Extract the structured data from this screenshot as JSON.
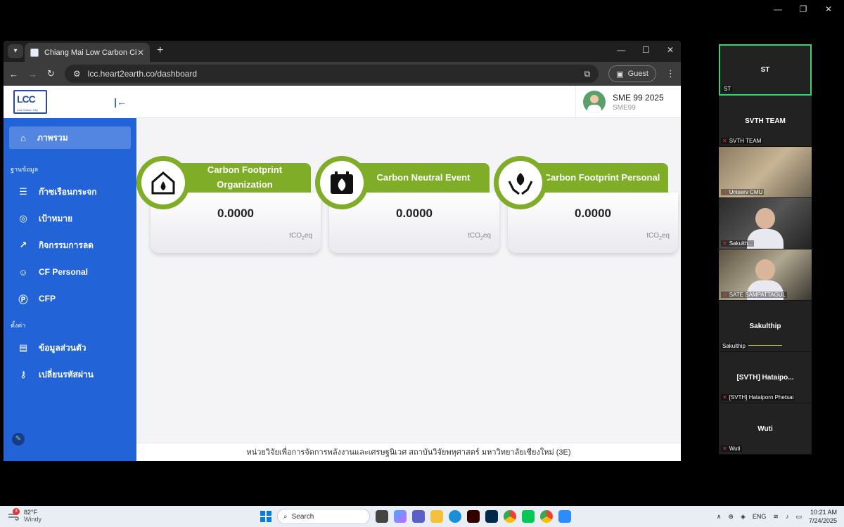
{
  "browser": {
    "tab_title": "Chiang Mai Low Carbon City",
    "url": "lcc.heart2earth.co/dashboard",
    "guest_label": "Guest"
  },
  "sidebar": {
    "logo_text": "LCC",
    "logo_sub": "Low Carbon City",
    "active_item": "ภาพรวม",
    "section_data": "ฐานข้อมูล",
    "data_items": [
      {
        "label": "ก๊าซเรือนกระจก"
      },
      {
        "label": "เป้าหมาย"
      },
      {
        "label": "กิจกรรมการลด"
      },
      {
        "label": "CF Personal"
      },
      {
        "label": "CFP"
      }
    ],
    "section_settings": "ตั้งค่า",
    "settings_items": [
      {
        "label": "ข้อมูลส่วนตัว"
      },
      {
        "label": "เปลี่ยนรหัสผ่าน"
      }
    ]
  },
  "user": {
    "name": "SME 99 2025",
    "id": "SME99"
  },
  "cards": [
    {
      "title": "Carbon Footprint Organization",
      "value": "0.0000",
      "unit_pre": "tCO",
      "unit_sub": "2",
      "unit_post": "eq"
    },
    {
      "title": "Carbon Neutral Event",
      "value": "0.0000",
      "unit_pre": "tCO",
      "unit_sub": "2",
      "unit_post": "eq"
    },
    {
      "title": "Carbon Footprint Personal",
      "value": "0.0000",
      "unit_pre": "tCO",
      "unit_sub": "2",
      "unit_post": "eq"
    }
  ],
  "footer": "หน่วยวิจัยเพื่อการจัดการพลังงานและเศรษฐนิเวศ สถาบันวิจัยพหุศาสตร์ มหาวิทยาลัยเชียงใหม่ (3E)",
  "participants": [
    {
      "name": "ST",
      "label": "ST"
    },
    {
      "name": "SVTH TEAM",
      "label": "SVTH TEAM"
    },
    {
      "label": "Uniserv CMU"
    },
    {
      "label": "Sakulth..."
    },
    {
      "label": "SATE SAMPATTAGUL"
    },
    {
      "name": "Sakulthip",
      "label": "Sakulthip"
    },
    {
      "name": "[SVTH]  Hataipo...",
      "label": "[SVTH] Hataiporn Phetsai"
    },
    {
      "name": "Wuti",
      "label": "Wuti"
    }
  ],
  "taskbar": {
    "weather_badge": "3",
    "temp": "82°F",
    "condition": "Windy",
    "search": "Search",
    "lang": "ENG",
    "time": "10:21 AM",
    "date": "7/24/2025"
  },
  "colors": {
    "sidebar": "#2264d8",
    "card_green": "#7fad28"
  }
}
